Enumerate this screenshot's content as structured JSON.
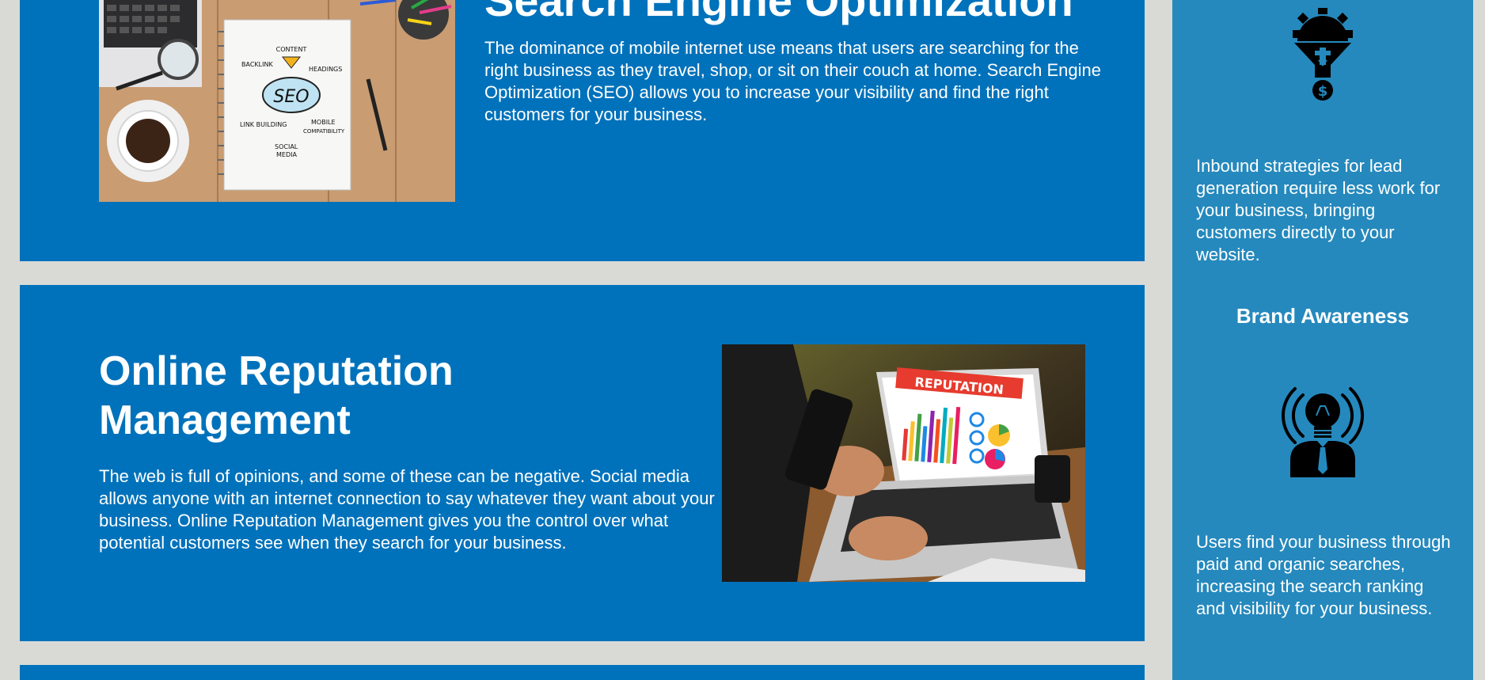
{
  "seo": {
    "title": "Search Engine Optimization",
    "description": "The dominance of mobile internet use means that users are searching for the right business as they travel, shop, or sit on their couch at home. Search Engine Optimization (SEO) allows you to increase your visibility and find the right customers for your business.",
    "image_words": {
      "backlink": "BACKLINK",
      "content": "CONTENT",
      "headings": "HEADINGS",
      "seo": "SEO",
      "link_building": "LINK BUILDING",
      "mobile": "MOBILE",
      "compatibility": "COMPATIBILITY",
      "social": "SOCIAL",
      "media": "MEDIA"
    }
  },
  "orm": {
    "title": "Online Reputation Management",
    "description": "The web is full of opinions, and some of these can be negative. Social media allows anyone with an internet connection to say whatever they want about your business. Online Reputation Management gives you the control over what potential customers see when they search for your business.",
    "image_banner": "REPUTATION"
  },
  "sidebar": {
    "lead_gen_text": "Inbound strategies for lead generation require less work for your business, bringing customers directly to your website.",
    "brand_heading": "Brand Awareness",
    "brand_text": "Users find your business through paid and organic searches, increasing the search ranking and visibility for your business.",
    "icons": [
      "funnel-gear-dollar-icon",
      "person-lightbulb-icon"
    ]
  },
  "colors": {
    "page_bg": "#d9dad6",
    "card_bg": "#0072bb",
    "sidebar_bg": "#2589bd",
    "text": "#ffffff",
    "icon": "#000000"
  }
}
